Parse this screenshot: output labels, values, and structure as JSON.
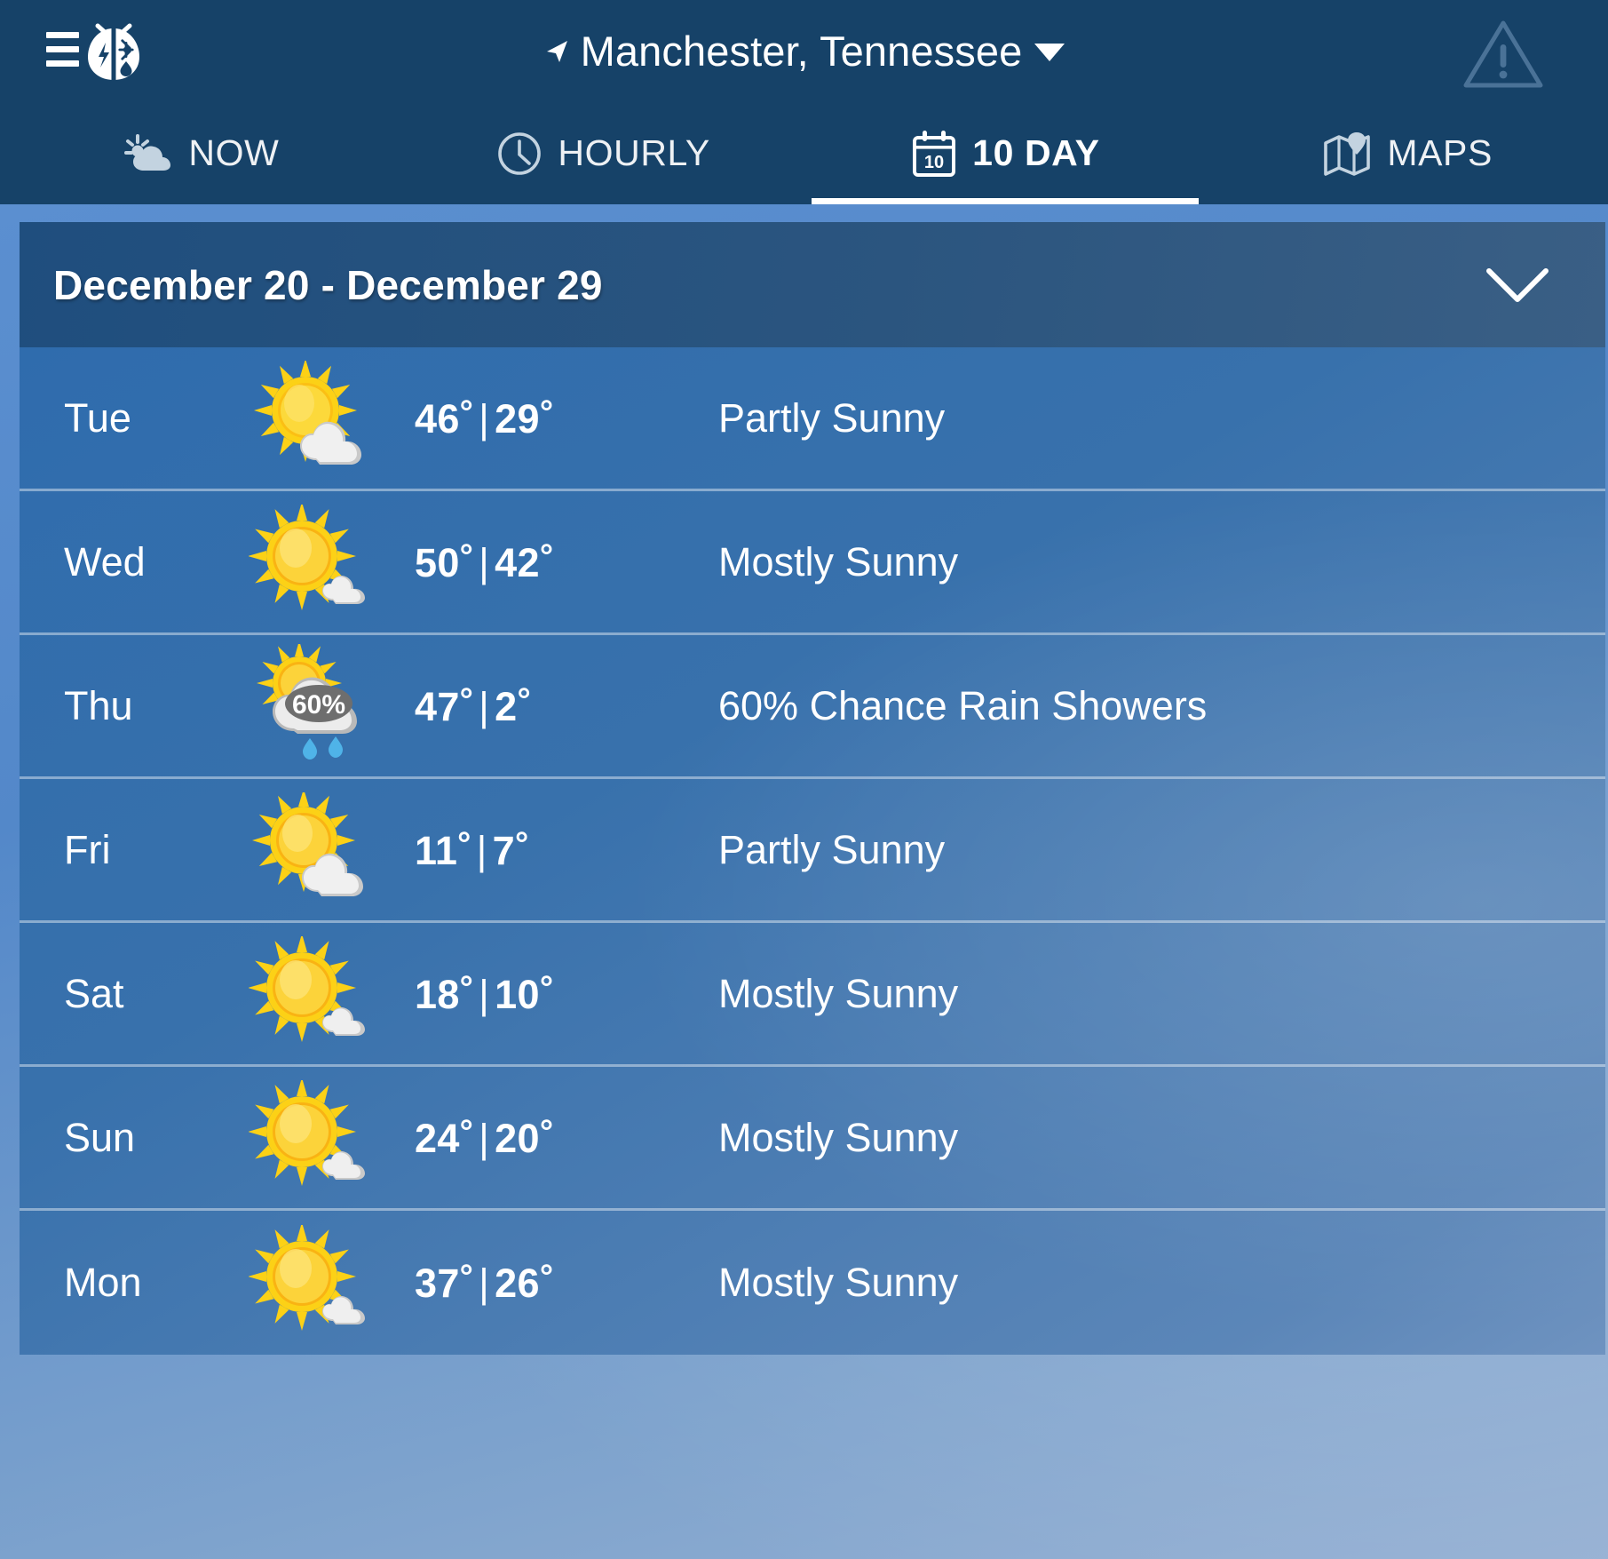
{
  "header": {
    "menu_icon": "hamburger-menu-icon",
    "logo_icon": "weatherbug-logo-icon",
    "location": "Manchester, Tennessee",
    "location_arrow_icon": "navigation-arrow-icon",
    "location_caret_icon": "chevron-down-icon",
    "alert_icon": "warning-triangle-icon"
  },
  "tabs": [
    {
      "label": "NOW",
      "icon": "sun-cloud-icon",
      "active": false
    },
    {
      "label": "HOURLY",
      "icon": "clock-icon",
      "active": false
    },
    {
      "label": "10 DAY",
      "icon": "calendar-10-icon",
      "active": true
    },
    {
      "label": "MAPS",
      "icon": "map-pin-icon",
      "active": false
    }
  ],
  "range": {
    "title": "December 20 - December 29",
    "chevron_icon": "chevron-down-icon"
  },
  "forecast": {
    "rows": [
      {
        "day": "Tue",
        "icon": "partly-sunny-icon",
        "high": "46",
        "low": "29",
        "sep": "|",
        "desc": "Partly Sunny"
      },
      {
        "day": "Wed",
        "icon": "mostly-sunny-icon",
        "high": "50",
        "low": "42",
        "sep": "|",
        "desc": "Mostly Sunny"
      },
      {
        "day": "Thu",
        "icon": "rain-showers-60-icon",
        "icon_badge": "60%",
        "high": "47",
        "low": "2",
        "sep": "|",
        "desc": "60% Chance Rain Showers"
      },
      {
        "day": "Fri",
        "icon": "partly-sunny-icon",
        "high": "11",
        "low": "7",
        "sep": "|",
        "desc": "Partly Sunny"
      },
      {
        "day": "Sat",
        "icon": "mostly-sunny-icon",
        "high": "18",
        "low": "10",
        "sep": "|",
        "desc": "Mostly Sunny"
      },
      {
        "day": "Sun",
        "icon": "mostly-sunny-icon",
        "high": "24",
        "low": "20",
        "sep": "|",
        "desc": "Mostly Sunny"
      },
      {
        "day": "Mon",
        "icon": "mostly-sunny-icon",
        "high": "37",
        "low": "26",
        "sep": "|",
        "desc": "Mostly Sunny"
      }
    ]
  },
  "colors": {
    "topbar": "#164268",
    "range_header": "#2b557f",
    "row_blue": "#3871ac",
    "page_blue": "#5b8fd0",
    "text": "#ffffff",
    "sun_yellow": "#fbd51e",
    "sun_orange": "#f5a81c",
    "cloud_gray": "#e3e3e3",
    "raindrop_blue": "#4fb3e8"
  }
}
